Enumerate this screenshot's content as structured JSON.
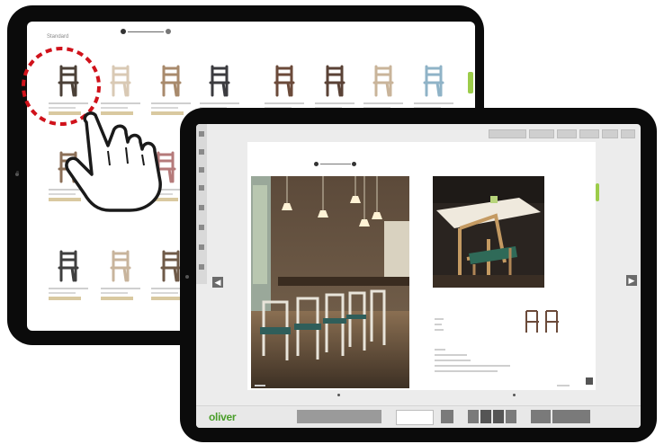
{
  "brand": {
    "logo_text": "oliver",
    "accent": "#4a9e2a"
  },
  "catalog_screen": {
    "section_label": "Standard",
    "chairs": [
      {
        "color": "#4b4037"
      },
      {
        "color": "#d9c9b4"
      },
      {
        "color": "#a88a6c"
      },
      {
        "color": "#3b3b3f"
      },
      {
        "color": "#6b4a3a"
      },
      {
        "color": "#5a4236"
      },
      {
        "color": "#c9b49a"
      },
      {
        "color": "#8fb3c7"
      },
      {
        "color": "#8b6f57"
      },
      {
        "color": "#b57a7a"
      },
      {
        "color": "#3f3f3f"
      },
      {
        "color": "#c8b49c"
      },
      {
        "color": "#6f5a48"
      }
    ]
  },
  "viewer_screen": {
    "toolbar_buttons": [
      "",
      "",
      "",
      "",
      "",
      ""
    ],
    "left_arrow": "◀",
    "right_arrow": "▶",
    "bottom_center_label": ""
  },
  "annotation": {
    "highlight_color": "#d0121b"
  }
}
